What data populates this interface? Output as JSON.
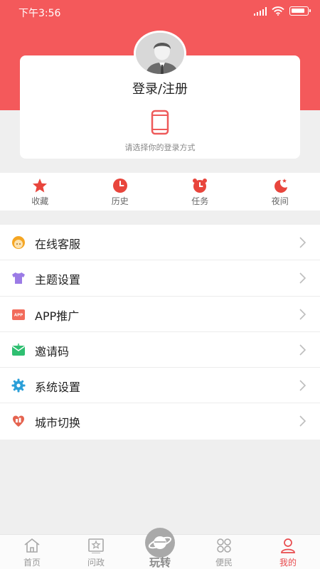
{
  "status_bar": {
    "time": "下午3:56"
  },
  "login": {
    "title": "登录/注册",
    "hint": "请选择你的登录方式"
  },
  "quick_actions": [
    {
      "label": "收藏",
      "icon": "star-icon"
    },
    {
      "label": "历史",
      "icon": "clock-icon"
    },
    {
      "label": "任务",
      "icon": "alarm-clock-icon"
    },
    {
      "label": "夜间",
      "icon": "moon-icon"
    }
  ],
  "menu": [
    {
      "label": "在线客服",
      "icon": "customer-service-icon",
      "color": "#f5a623"
    },
    {
      "label": "主题设置",
      "icon": "tshirt-icon",
      "color": "#9b7be6"
    },
    {
      "label": "APP推广",
      "icon": "app-icon",
      "badge_text": "APP",
      "color": "#f26b5b"
    },
    {
      "label": "邀请码",
      "icon": "envelope-icon",
      "color": "#2fbf71"
    },
    {
      "label": "系统设置",
      "icon": "gear-icon",
      "color": "#2a9fd8"
    },
    {
      "label": "城市切换",
      "icon": "city-switch-icon",
      "color": "#e5634f"
    }
  ],
  "tabs": [
    {
      "label": "首页",
      "icon": "home-icon"
    },
    {
      "label": "问政",
      "icon": "inquiry-icon"
    },
    {
      "label": "玩转",
      "icon": "planet-icon"
    },
    {
      "label": "便民",
      "icon": "grid-icon"
    },
    {
      "label": "我的",
      "icon": "user-icon",
      "active": true
    }
  ],
  "colors": {
    "brand": "#f4595b",
    "active_tab": "#e84a4d"
  }
}
